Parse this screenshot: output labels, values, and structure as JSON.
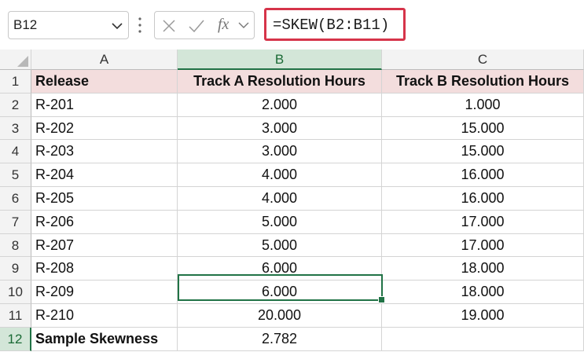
{
  "name_box": {
    "value": "B12"
  },
  "formula_bar": {
    "formula": "=SKEW(B2:B11)",
    "fx_label": "fx"
  },
  "columns": [
    "A",
    "B",
    "C"
  ],
  "selected_column": "B",
  "selected_row": "12",
  "rows": [
    {
      "num": "1",
      "cells": [
        "Release",
        "Track A Resolution Hours",
        "Track B Resolution Hours"
      ]
    },
    {
      "num": "2",
      "cells": [
        "R-201",
        "2.000",
        "1.000"
      ]
    },
    {
      "num": "3",
      "cells": [
        "R-202",
        "3.000",
        "15.000"
      ]
    },
    {
      "num": "4",
      "cells": [
        "R-203",
        "3.000",
        "15.000"
      ]
    },
    {
      "num": "5",
      "cells": [
        "R-204",
        "4.000",
        "16.000"
      ]
    },
    {
      "num": "6",
      "cells": [
        "R-205",
        "4.000",
        "16.000"
      ]
    },
    {
      "num": "7",
      "cells": [
        "R-206",
        "5.000",
        "17.000"
      ]
    },
    {
      "num": "8",
      "cells": [
        "R-207",
        "5.000",
        "17.000"
      ]
    },
    {
      "num": "9",
      "cells": [
        "R-208",
        "6.000",
        "18.000"
      ]
    },
    {
      "num": "10",
      "cells": [
        "R-209",
        "6.000",
        "18.000"
      ]
    },
    {
      "num": "11",
      "cells": [
        "R-210",
        "20.000",
        "19.000"
      ]
    },
    {
      "num": "12",
      "cells": [
        "Sample Skewness",
        "2.782",
        ""
      ]
    }
  ],
  "colors": {
    "accent_green": "#217346",
    "header_fill": "#f3dddd",
    "formula_highlight": "#d6344a"
  },
  "icons": [
    "chevron-down-icon",
    "more-dots-icon",
    "cancel-icon",
    "enter-icon",
    "function-icon"
  ]
}
